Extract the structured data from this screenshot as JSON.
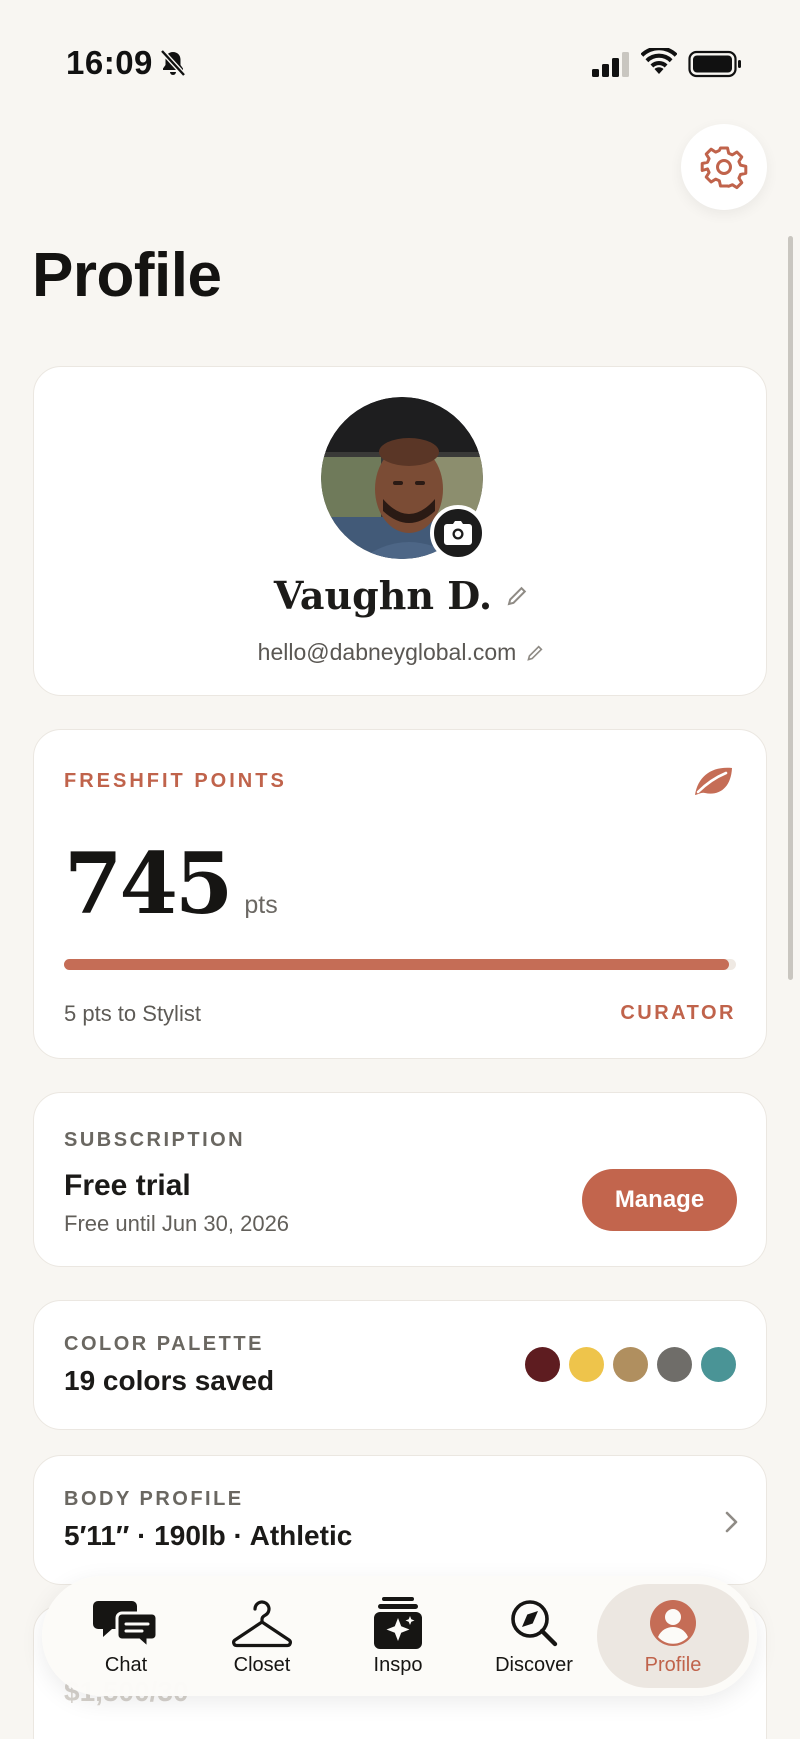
{
  "status_bar": {
    "time": "16:09",
    "icons": [
      "bell-slash-icon",
      "cellular-signal-icon",
      "wifi-icon",
      "battery-icon"
    ]
  },
  "header": {
    "title": "Profile",
    "settings_icon": "gear-icon"
  },
  "profile": {
    "name": "Vaughn D.",
    "email": "hello@dabneyglobal.com",
    "icons": [
      "avatar",
      "camera-icon",
      "pencil-icon"
    ]
  },
  "points": {
    "label": "FRESHFIT POINTS",
    "value": "745",
    "unit": "pts",
    "progress_fraction": 0.99,
    "hint": "5 pts to Stylist",
    "tier": "CURATOR",
    "icon": "leaf-icon"
  },
  "subscription": {
    "label": "SUBSCRIPTION",
    "plan": "Free trial",
    "detail": "Free until Jun 30, 2026",
    "manage_label": "Manage"
  },
  "palette": {
    "label": "COLOR PALETTE",
    "count_text": "19 colors saved",
    "swatches": [
      "#5e1c20",
      "#eec44b",
      "#b08f5f",
      "#6f6d69",
      "#4a9496"
    ]
  },
  "body_profile": {
    "label": "BODY PROFILE",
    "stats": "5′11″ · 190lb · Athletic",
    "icon": "chevron-right-icon"
  },
  "peek_card": {
    "text": "$1,500/30"
  },
  "tab_bar": {
    "tabs": [
      {
        "label": "Chat",
        "icon": "chat-bubbles-icon",
        "active": false
      },
      {
        "label": "Closet",
        "icon": "hanger-icon",
        "active": false
      },
      {
        "label": "Inspo",
        "icon": "inspo-sparkle-icon",
        "active": false
      },
      {
        "label": "Discover",
        "icon": "compass-search-icon",
        "active": false
      },
      {
        "label": "Profile",
        "icon": "person-icon",
        "active": true
      }
    ]
  },
  "colors": {
    "accent": "#c2654d",
    "background": "#f8f6f2",
    "card": "#ffffff"
  }
}
